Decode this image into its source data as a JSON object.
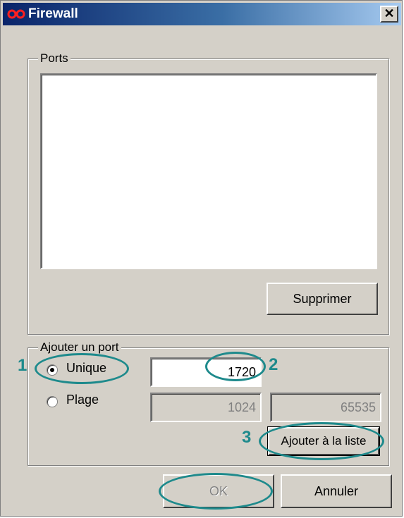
{
  "window": {
    "title": "Firewall",
    "close_glyph": "✕",
    "icon": "infinity-logo-icon"
  },
  "ports_group": {
    "label": "Ports",
    "items": [],
    "remove_label": "Supprimer"
  },
  "add_group": {
    "label": "Ajouter un port",
    "radio_single": {
      "label": "Unique",
      "selected": true
    },
    "radio_range": {
      "label": "Plage",
      "selected": false
    },
    "single_value": "1720",
    "range_from": "1024",
    "range_to": "65535",
    "add_label": "Ajouter à la liste"
  },
  "footer": {
    "ok_label": "OK",
    "cancel_label": "Annuler"
  },
  "annotations": {
    "step1": "1",
    "step2": "2",
    "step3": "3",
    "color": "#1e8a8c"
  },
  "colors": {
    "dialog_bg": "#d4d0c8",
    "title_start": "#0a246a",
    "title_end": "#a6caf0"
  }
}
